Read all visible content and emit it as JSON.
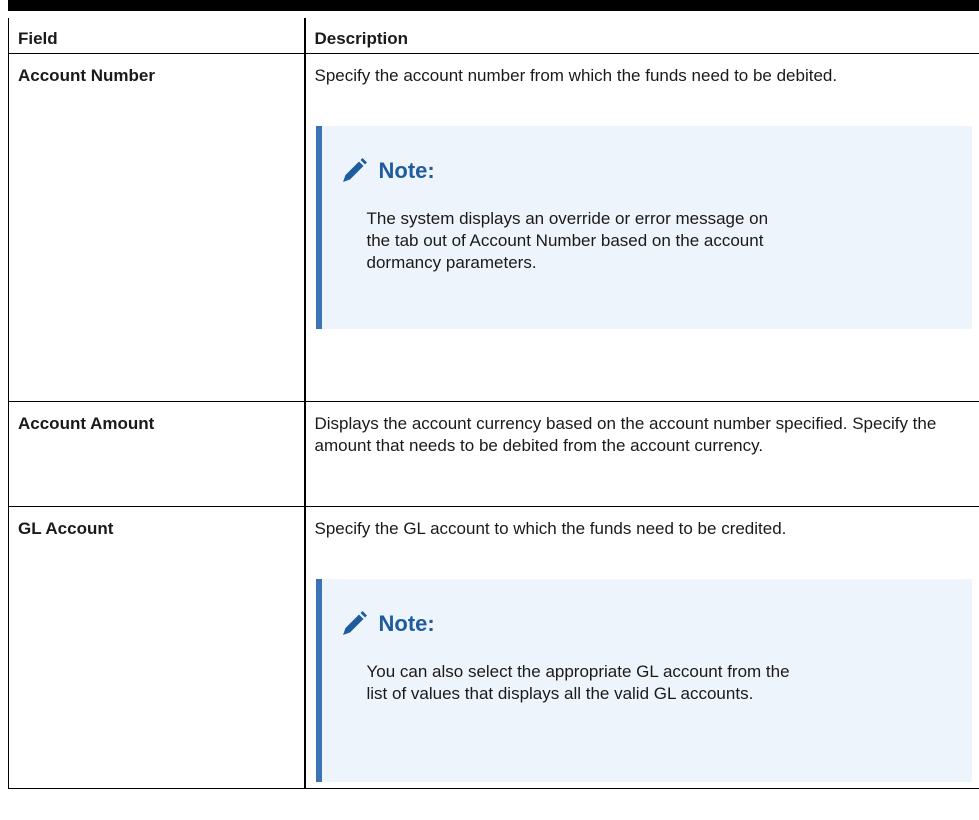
{
  "table": {
    "headers": {
      "field": "Field",
      "description": "Description"
    },
    "rows": [
      {
        "field": "Account Number",
        "description": "Specify the account number from which the funds need to be debited.",
        "note": {
          "title": "Note:",
          "body": "The system displays an override or error message on the tab out of Account Number based on the account dormancy parameters."
        }
      },
      {
        "field": "Account Amount",
        "description": "Displays the account currency based on the account number specified. Specify the amount that needs to be debited from the account currency."
      },
      {
        "field": "GL Account",
        "description": "Specify the GL account to which the funds need to be credited.",
        "note": {
          "title": "Note:",
          "body": "You can also select the appropriate GL account from the list of values that displays all the valid GL accounts."
        }
      }
    ]
  },
  "icons": {
    "note": "pencil-icon"
  },
  "colors": {
    "note_accent": "#3a74b5",
    "note_title": "#1f5c9e",
    "note_bg": "#eef4fb"
  }
}
